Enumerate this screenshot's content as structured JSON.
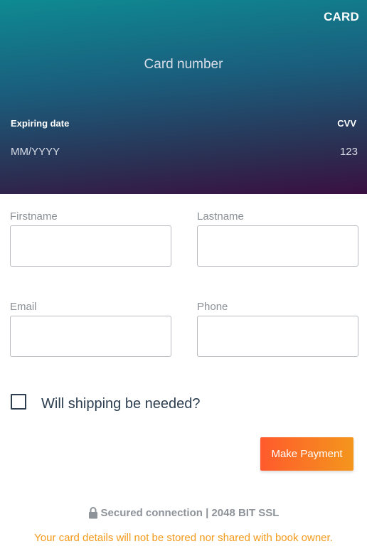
{
  "card": {
    "brand": "CARD",
    "number_placeholder": "Card number",
    "expiry_label": "Expiring date",
    "expiry_placeholder": "MM/YYYY",
    "cvv_label": "CVV",
    "cvv_placeholder": "123"
  },
  "form": {
    "firstname": {
      "label": "Firstname",
      "value": ""
    },
    "lastname": {
      "label": "Lastname",
      "value": ""
    },
    "email": {
      "label": "Email",
      "value": ""
    },
    "phone": {
      "label": "Phone",
      "value": ""
    },
    "shipping_checkbox": {
      "label": "Will shipping be needed?",
      "checked": false
    }
  },
  "actions": {
    "pay_label": "Make Payment"
  },
  "footer": {
    "secure_icon": "lock-icon",
    "secure_text": "Secured connection | 2048 BIT SSL",
    "notice": "Your card details will not be stored nor shared with book owner."
  },
  "colors": {
    "button_start": "#ff5a2c",
    "button_end": "#f4961c",
    "notice": "#f39a1b",
    "header_top": "#0e8a92",
    "header_bottom": "#3a0f42"
  }
}
